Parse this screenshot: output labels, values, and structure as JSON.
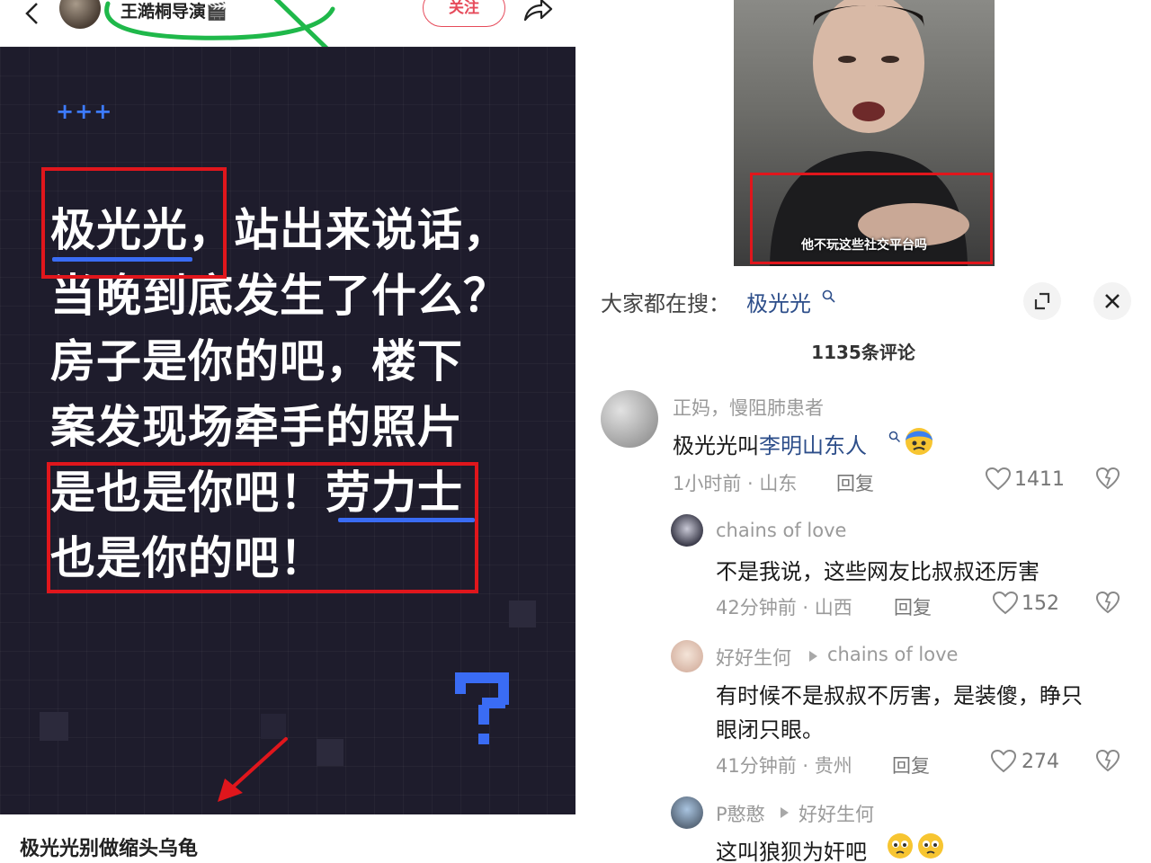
{
  "left_post": {
    "author_name": "王澔桐导演🎬",
    "follow_label": "关注",
    "plus_marks": "+++",
    "lines": [
      "极光光，站出来说话，",
      "当晚到底发生了什么？",
      "房子是你的吧，楼下",
      "案发现场牵手的照片",
      "是也是你吧！劳力士",
      "也是你的吧！"
    ],
    "caption": "极光光别做缩头乌龟"
  },
  "video": {
    "subtitle": "他不玩这些社交平台吗"
  },
  "comments_sheet": {
    "search_prefix": "大家都在搜：",
    "search_term": "极光光",
    "comment_count": "1135条评论",
    "comments": [
      {
        "user": "正妈，慢阻肺患者",
        "text_plain": "极光光叫",
        "text_link": "李明山东人",
        "time_location": "1小时前 · 山东",
        "reply_label": "回复",
        "likes": "1411"
      },
      {
        "user": "chains of love",
        "text": "不是我说，这些网友比叔叔还厉害",
        "time_location": "42分钟前 · 山西",
        "reply_label": "回复",
        "likes": "152"
      },
      {
        "user": "好好生何",
        "reply_to": "chains of love",
        "text_line1": "有时候不是叔叔不厉害，是装傻，睁只",
        "text_line2": "眼闭只眼。",
        "time_location": "41分钟前 · 贵州",
        "reply_label": "回复",
        "likes": "274"
      },
      {
        "user": "P憨憨",
        "reply_to": "好好生何",
        "text": "这叫狼狈为奸吧"
      }
    ]
  },
  "colors": {
    "post_bg": "#1e1c2c",
    "highlight_red": "#e0161c",
    "underline_blue": "#3a6cf4",
    "follow_red": "#e64a5a",
    "link_blue": "#2d4e8a",
    "scribble_green": "#1fb84a"
  },
  "icons": [
    "back-icon",
    "clapper-icon",
    "share-icon",
    "question-icon",
    "search-icon",
    "expand-icon",
    "close-icon",
    "heart-icon",
    "dislike-icon",
    "emoji-icon"
  ]
}
